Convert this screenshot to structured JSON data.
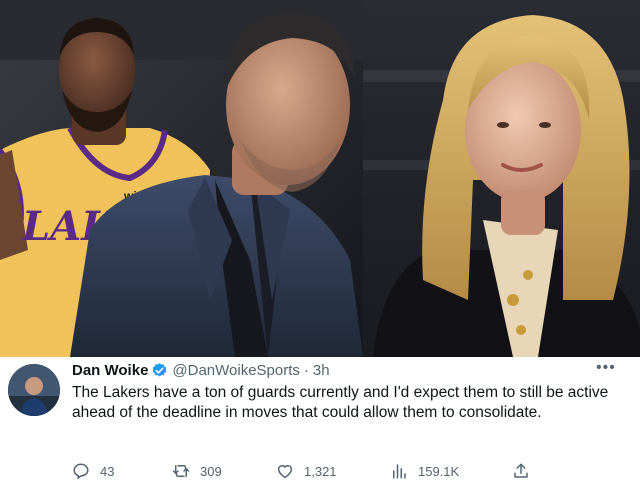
{
  "photos": {
    "left": {
      "jersey_text": "LAKE",
      "jersey_patch": "wish"
    }
  },
  "tweet": {
    "author_name": "Dan Woike",
    "handle": "@DanWoikeSports",
    "separator": "·",
    "time": "3h",
    "text": "The Lakers have a ton of guards currently and I'd expect them to still be active ahead of the deadline in moves that could allow them to consolidate.",
    "more_label": "•••",
    "verified_color": "#1d9bf0",
    "actions": {
      "replies": "43",
      "retweets": "309",
      "likes": "1,321",
      "views": "159.1K"
    }
  },
  "icons": [
    "verified-badge-icon",
    "more-icon",
    "reply-icon",
    "retweet-icon",
    "like-icon",
    "views-icon",
    "share-icon"
  ]
}
